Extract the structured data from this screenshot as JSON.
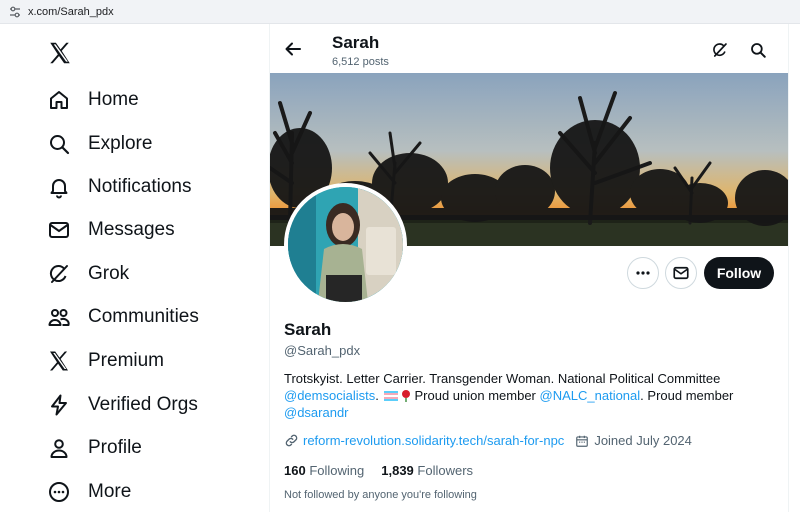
{
  "browser": {
    "url": "x.com/Sarah_pdx"
  },
  "sidebar": {
    "items": [
      {
        "label": "Home",
        "icon": "home-icon"
      },
      {
        "label": "Explore",
        "icon": "search-icon"
      },
      {
        "label": "Notifications",
        "icon": "bell-icon"
      },
      {
        "label": "Messages",
        "icon": "envelope-icon"
      },
      {
        "label": "Grok",
        "icon": "grok-icon"
      },
      {
        "label": "Communities",
        "icon": "people-icon"
      },
      {
        "label": "Premium",
        "icon": "x-logo-icon"
      },
      {
        "label": "Verified Orgs",
        "icon": "lightning-icon"
      },
      {
        "label": "Profile",
        "icon": "person-icon"
      },
      {
        "label": "More",
        "icon": "more-circle-icon"
      }
    ]
  },
  "header": {
    "name": "Sarah",
    "posts": "6,512 posts"
  },
  "profile": {
    "name": "Sarah",
    "handle": "@Sarah_pdx",
    "bio": {
      "part1": "Trotskyist. Letter Carrier. Transgender Woman. National Political Committee",
      "mention1": "@demsocialists",
      "part2": ".",
      "part3": "Proud union member",
      "mention2": "@NALC_national",
      "part4": ". Proud member",
      "mention3": "@dsarandr"
    },
    "website": "reform-revolution.solidarity.tech/sarah-for-npc",
    "joined": "Joined July 2024",
    "following_count": "160",
    "following_label": "Following",
    "followers_count": "1,839",
    "followers_label": "Followers",
    "not_followed": "Not followed by anyone you're following"
  },
  "actions": {
    "follow_label": "Follow"
  },
  "colors": {
    "accent": "#1d9bf0",
    "text": "#0f1419",
    "muted": "#536471"
  }
}
